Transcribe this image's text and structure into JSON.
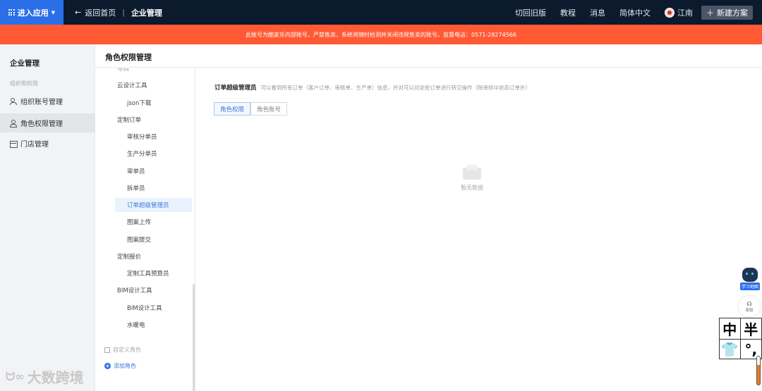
{
  "topbar": {
    "enter_app": "进入应用",
    "back": "返回首页",
    "breadcrumb_current": "企业管理",
    "nav": [
      "切回旧版",
      "教程",
      "消息",
      "简体中文"
    ],
    "user": "江南",
    "new_button": "新建方案"
  },
  "alert": {
    "text": "此账号为酷家乐内部账号，严禁售卖，系统将随时检测并关闭违规售卖的账号。监督电话：0571-28274566"
  },
  "sidebar": {
    "title": "企业管理",
    "group": "组织和权限",
    "items": [
      {
        "label": "组织账号管理",
        "icon": "users-icon",
        "active": false
      },
      {
        "label": "角色权限管理",
        "icon": "user-icon",
        "active": true
      },
      {
        "label": "门店管理",
        "icon": "store-icon",
        "active": false
      }
    ]
  },
  "page": {
    "title": "角色权限管理"
  },
  "tree": {
    "partial_top": "导购",
    "nodes": [
      "云设计工具",
      "json下载",
      "定制订单",
      "审核分单员",
      "生产分单员",
      "审单员",
      "拆单员",
      "订单超级管理员",
      "图案上传",
      "图案提交",
      "定制报价",
      "定制工具预算员",
      "BIM设计工具",
      "BIM设计工具",
      "水暖电"
    ],
    "custom_role": "自定义角色",
    "add_role": "添加角色"
  },
  "content": {
    "role_name": "订单超级管理员",
    "role_desc": "可以看到所有订单（客户订单、审核单、生产单）信息，并对可以对这些订单进行转交操作（除审核中状态订单外）",
    "tabs": [
      "角色权限",
      "角色账号"
    ],
    "empty_text": "暂无数据"
  },
  "float": {
    "assistant_label": "学习地图",
    "service_label": "客服",
    "logo_chars": [
      "中",
      "半",
      "👕",
      "°,"
    ]
  },
  "watermark": "大数跨境",
  "colors": {
    "topbar": "#0b1a2d",
    "accent": "#2a6fe8",
    "alert": "#ff5a33"
  }
}
